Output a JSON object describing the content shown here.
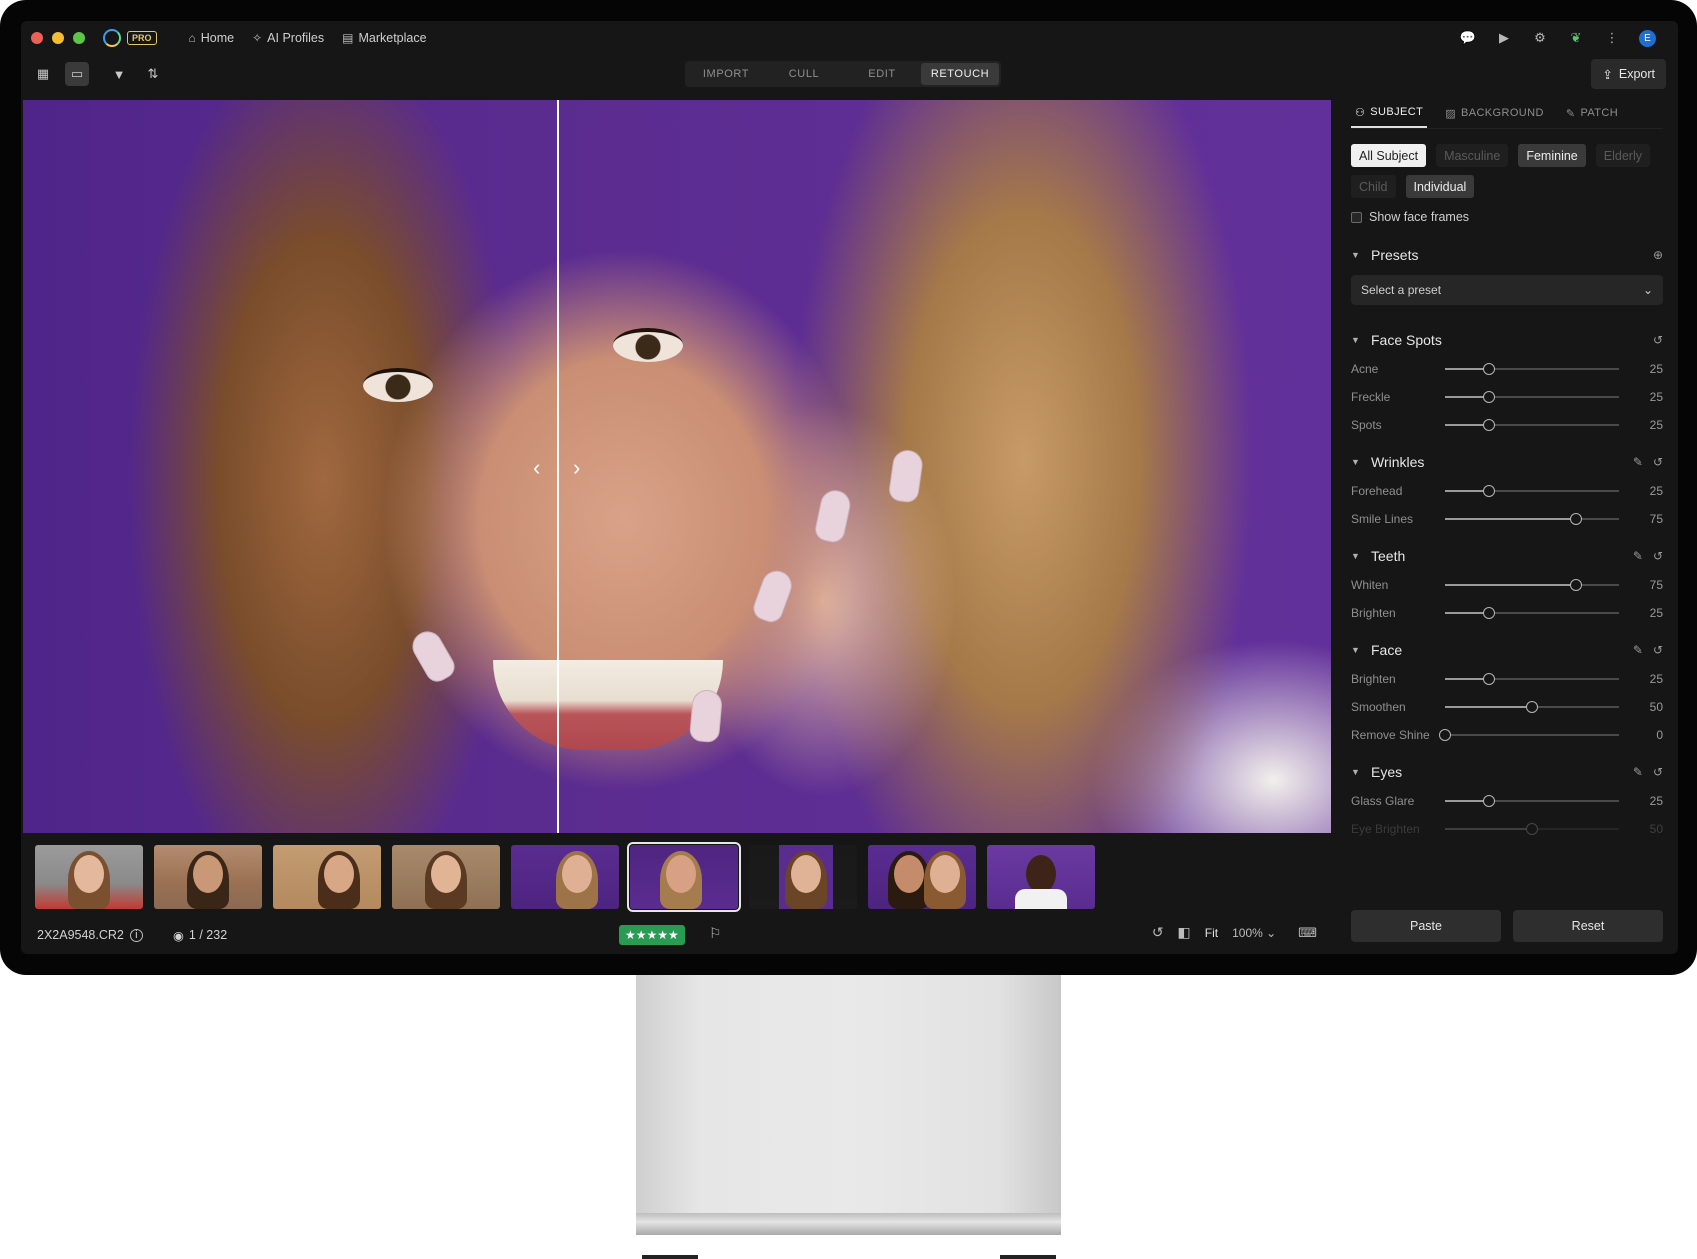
{
  "app": {
    "badge": "PRO",
    "nav": [
      {
        "label": "Home",
        "icon": "home-icon"
      },
      {
        "label": "AI Profiles",
        "icon": "ai-profiles-icon"
      },
      {
        "label": "Marketplace",
        "icon": "marketplace-icon"
      }
    ],
    "avatar_letter": "E"
  },
  "toolbar": {
    "modes": [
      "IMPORT",
      "CULL",
      "EDIT",
      "RETOUCH"
    ],
    "active_mode": "RETOUCH",
    "export_label": "Export"
  },
  "status": {
    "filename": "2X2A9548.CR2",
    "count": "1 / 232",
    "rating_stars": "★★★★★",
    "rating": 5,
    "fit_label": "Fit",
    "zoom": "100%"
  },
  "filmstrip": {
    "thumbnails": 9,
    "selected_index": 5
  },
  "panel": {
    "tabs": [
      "SUBJECT",
      "BACKGROUND",
      "PATCH"
    ],
    "active_tab": "SUBJECT",
    "chips": [
      {
        "label": "All Subject",
        "state": "highlight"
      },
      {
        "label": "Masculine",
        "state": "disabled"
      },
      {
        "label": "Feminine",
        "state": "on"
      },
      {
        "label": "Elderly",
        "state": "disabled"
      },
      {
        "label": "Child",
        "state": "disabled"
      },
      {
        "label": "Individual",
        "state": "on"
      }
    ],
    "show_face_frames": "Show face frames",
    "presets": {
      "title": "Presets",
      "placeholder": "Select a preset"
    },
    "sections": [
      {
        "title": "Face Spots",
        "edit": false,
        "sliders": [
          {
            "label": "Acne",
            "value": 25
          },
          {
            "label": "Freckle",
            "value": 25
          },
          {
            "label": "Spots",
            "value": 25
          }
        ]
      },
      {
        "title": "Wrinkles",
        "edit": true,
        "sliders": [
          {
            "label": "Forehead",
            "value": 25
          },
          {
            "label": "Smile Lines",
            "value": 75
          }
        ]
      },
      {
        "title": "Teeth",
        "edit": true,
        "sliders": [
          {
            "label": "Whiten",
            "value": 75
          },
          {
            "label": "Brighten",
            "value": 25
          }
        ]
      },
      {
        "title": "Face",
        "edit": true,
        "sliders": [
          {
            "label": "Brighten",
            "value": 25
          },
          {
            "label": "Smoothen",
            "value": 50
          },
          {
            "label": "Remove Shine",
            "value": 0
          }
        ]
      },
      {
        "title": "Eyes",
        "edit": true,
        "sliders": [
          {
            "label": "Glass Glare",
            "value": 25
          },
          {
            "label": "Eye Brighten",
            "value": 50,
            "faded": true
          }
        ]
      }
    ],
    "paste_label": "Paste",
    "reset_label": "Reset"
  },
  "colors": {
    "background": "#161616",
    "accent_green": "#2a9b53",
    "photo_backdrop": "#5b2c90"
  }
}
